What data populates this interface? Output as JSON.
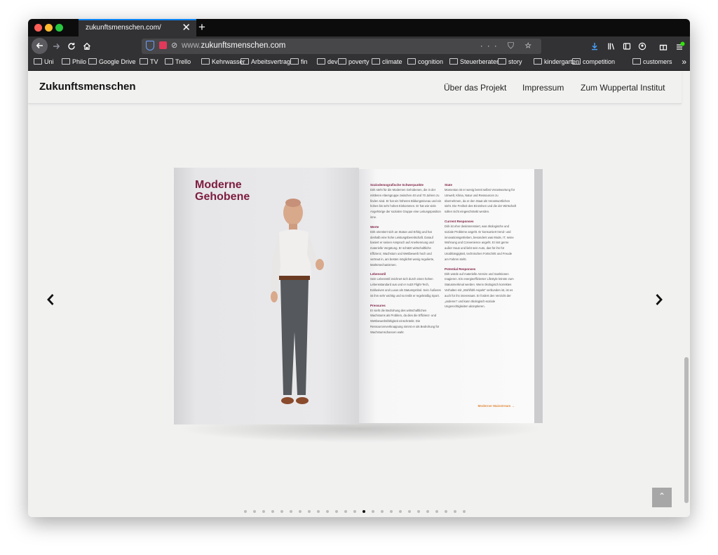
{
  "browser": {
    "tab_title": "zukunftsmenschen.com/",
    "tab_close": "✕",
    "new_tab": "+",
    "url_prefix": "www.",
    "url_host": "zukunftsmenschen.com",
    "url_actions": "··· ⛉ ☆"
  },
  "bookmarks": [
    "Uni",
    "Philo",
    "Google Drive",
    "TV",
    "Trello",
    "Kehrwasser",
    "Arbeitsvertrag",
    "fin",
    "dev",
    "poverty",
    "climate",
    "cognition",
    "Steuerberater",
    "story",
    "kindergarten",
    "competition",
    "customers"
  ],
  "site": {
    "logo": "Zukunftsmenschen",
    "nav": [
      "Über das Projekt",
      "Impressum",
      "Zum Wuppertal Institut"
    ]
  },
  "carousel": {
    "prev": "‹",
    "next": "›",
    "dot_count": 25,
    "active_dot": 13
  },
  "book": {
    "title": "Moderne\nGehobene",
    "col1": [
      {
        "h": "Soziodemografische Schwerpunkte",
        "b": "Dirk steht für die Modernen Gehobenen, die in der mittleren Altersgruppe zwischen 40 und 70 Jahren zu finden sind. Er hat ein höheres Bildungsniveau und ein hohes bis sehr hohes Einkommen. Er hat wie viele Angehörige der sozialen Gruppe eine Leitungsposition inne."
      },
      {
        "h": "Werte",
        "b": "Dirk orientiert sich an Status und Erfolg und hat deshalb eine hohe Leistungsbereitschaft. Darauf basiert er seinen Anspruch auf Anerkennung und materielle Vergütung. Er schätzt wirtschaftliche Effizienz, Wachstum und Wettbewerb hoch und vertraut in, am besten möglichst wenig regulierte, Marktmechanismen."
      },
      {
        "h": "Lebensstil",
        "b": "Sein Lebensstil zeichnet sich durch einen hohen Lebensstandard aus und er nutzt Flight-Tech, Exklusives und Luxus als Statussymbol. Sein Äußeres ist ihm sehr wichtig und so treibt er regelmäßig Sport."
      },
      {
        "h": "Pressures",
        "b": "Er sieht die Bedrohung des wirtschaftlichen Wachstums als Problem, da dies die Effizienz- und Wettbewerbsfähigkeit einschränkt. Die Ressourcenverknappung nimmt er als Bedrohung für Wachstumschancen wahr."
      }
    ],
    "col2": [
      {
        "h": "State",
        "b": "Momentan ist er wenig bereit selbst Verantwortung für Umwelt, Klima, Natur und Ressourcen zu übernehmen, da er den Staat als Verantwortlichen sieht. Die Freiheit des Einzelnen und die der Wirtschaft sollen nicht eingeschränkt werden."
      },
      {
        "h": "Current Responses",
        "b": "Dirk ist eher desinteressiert, was ökologische und soziale Probleme angeht. Er konsumiert trend- und innovationsgetrieben, besonders was Mode, IT, seine Wohnung und Convenience angeht. Er isst gerne außer Haus und liebt sein Auto, das für ihn für Unabhängigkeit, technischen Fortschritt und Freude am Fahren steht."
      },
      {
        "h": "Potential Responses",
        "b": "Dirk würde auf materielle Anreize und Sanktionen reagieren. Ein energieeffizienter Lifestyle könnte zum Statusmerkmal werden. Wenn ökologisch korrektes Verhalten mit „Wohlfühl-Aspekt\" verbunden ist, ist es auch für ihn interessant. Er fordert den Verzicht der „anderen\" und kann ökologisch-soziale Ungerechtigkeiten akzeptieren."
      }
    ],
    "link": "Moderner Mainstream →"
  },
  "to_top": "⌃"
}
